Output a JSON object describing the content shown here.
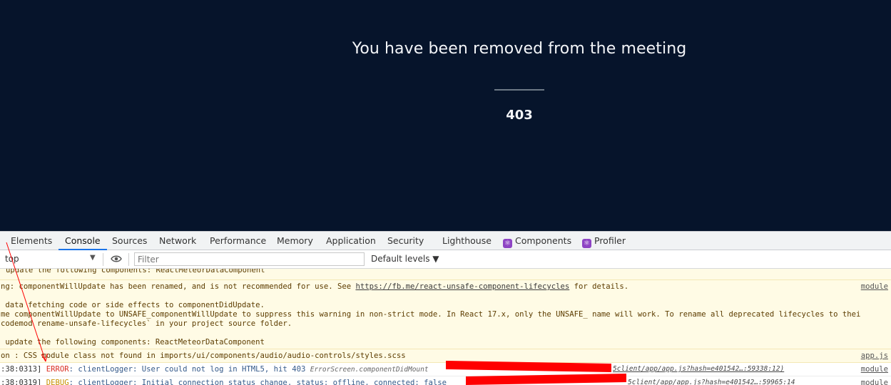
{
  "app": {
    "message": "You have been removed from the meeting",
    "code": "403"
  },
  "devtools": {
    "tabs": [
      {
        "label": "Elements"
      },
      {
        "label": "Console"
      },
      {
        "label": "Sources"
      },
      {
        "label": "Network"
      },
      {
        "label": "Performance"
      },
      {
        "label": "Memory"
      },
      {
        "label": "Application"
      },
      {
        "label": "Security"
      },
      {
        "label": "Lighthouse"
      },
      {
        "label": "Components"
      },
      {
        "label": "Profiler"
      }
    ],
    "toolbar": {
      "context": "top",
      "filter_placeholder": "Filter",
      "levels": "Default levels ▼"
    },
    "log": {
      "l1": "update the following components: ReactMeteorDataComponent",
      "l2_pre": "ng: componentWillUpdate has been renamed, and is not recommended for use. See ",
      "l2_link": "https://fb.me/react-unsafe-component-lifecycles",
      "l2_post": " for details.",
      "l2_src": "module",
      "l3": " data fetching code or side effects to componentDidUpdate.",
      "l4": "me componentWillUpdate to UNSAFE_componentWillUpdate to suppress this warning in non-strict mode. In React 17.x, only the UNSAFE_ name will work. To rename all deprecated lifecycles to thei",
      "l5": "codemod rename-unsafe-lifecycles` in your project source folder.",
      "l6": " update the following components: ReactMeteorDataComponent",
      "l7": "on : CSS module class not found in imports/ui/components/audio/audio-controls/styles.scss",
      "l7_src": "app.js",
      "err_time": ":38:0313] ",
      "err_level": "ERROR",
      "err_text": ": clientLogger: User could not log in HTML5, hit 403 ",
      "err_fn": "ErrorScreen.componentDidMount",
      "err_loc": "5client/app/app.js?hash=e401542…:59338:12)",
      "err_src": "module",
      "dbg_time": ":38:0319] ",
      "dbg_level": "DEBUG",
      "dbg_text": ": clientLogger: Initial connection status change. status: offline, connected: false",
      "dbg_loc": "5client/app/app.js?hash=e401542…:59965:14",
      "dbg_src": "module"
    }
  },
  "colors": {
    "app_bg": "#06142b",
    "error": "#d93025",
    "debug": "#c79000",
    "annotation": "#ff0000"
  }
}
